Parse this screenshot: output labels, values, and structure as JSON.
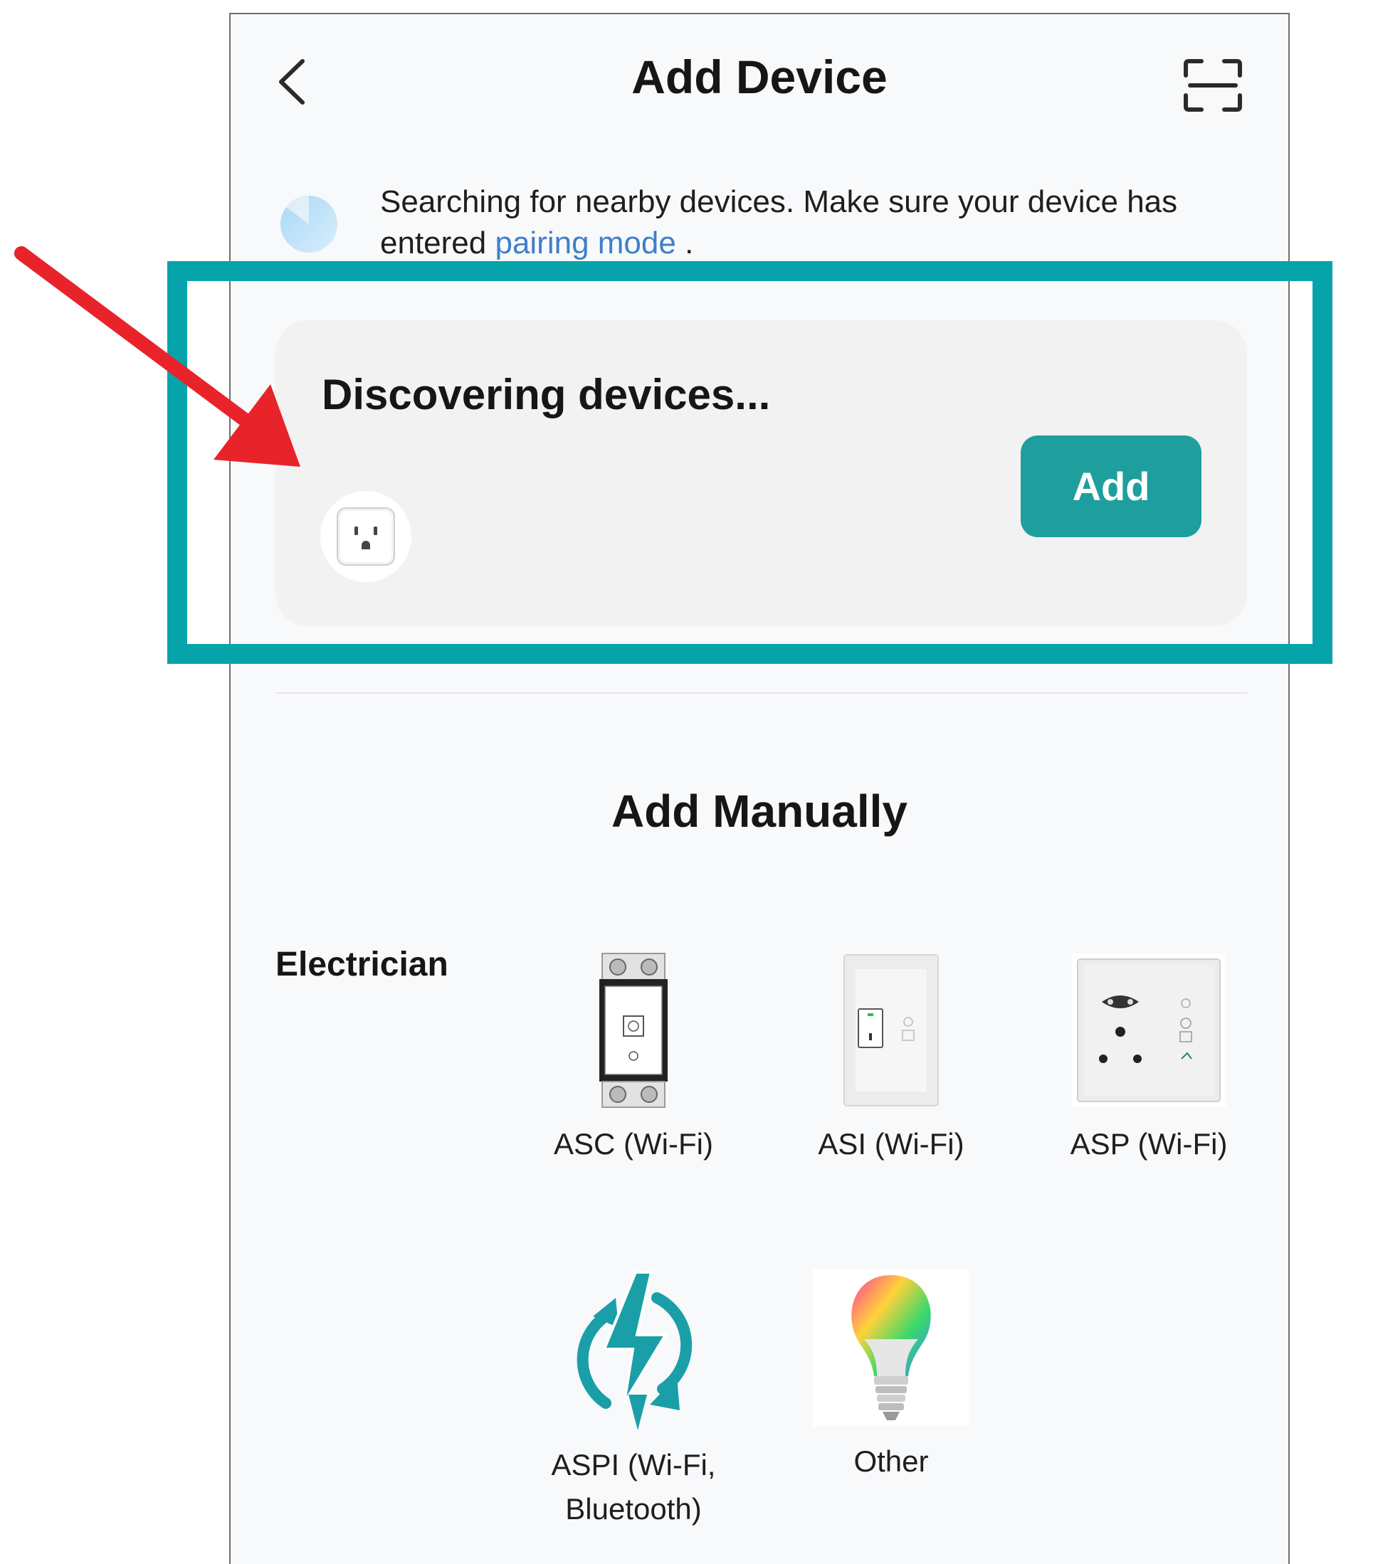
{
  "header": {
    "title": "Add Device"
  },
  "search_banner": {
    "text_before_link": "Searching for nearby devices. Make sure your device has entered ",
    "link_text": "pairing mode",
    "text_after_link": " .",
    "link_color": "#3f7fc8"
  },
  "discovery": {
    "title": "Discovering devices...",
    "add_label": "Add",
    "found_device_icon": "smart-plug-icon",
    "accent_color": "#1f9e9e"
  },
  "manual": {
    "title": "Add Manually",
    "category": "Electrician",
    "devices": [
      {
        "name": "ASC (Wi-Fi)",
        "icon": "circuit-breaker-icon"
      },
      {
        "name": "ASI (Wi-Fi)",
        "icon": "wall-switch-icon"
      },
      {
        "name": "ASP (Wi-Fi)",
        "icon": "wall-socket-icon"
      },
      {
        "name": "ASPI (Wi-Fi, Bluetooth)",
        "icon": "power-sync-icon"
      },
      {
        "name": "Other",
        "icon": "rgb-bulb-icon"
      }
    ]
  },
  "annotations": {
    "highlight_color": "#07a3aa",
    "arrow_color": "#e8232a"
  }
}
